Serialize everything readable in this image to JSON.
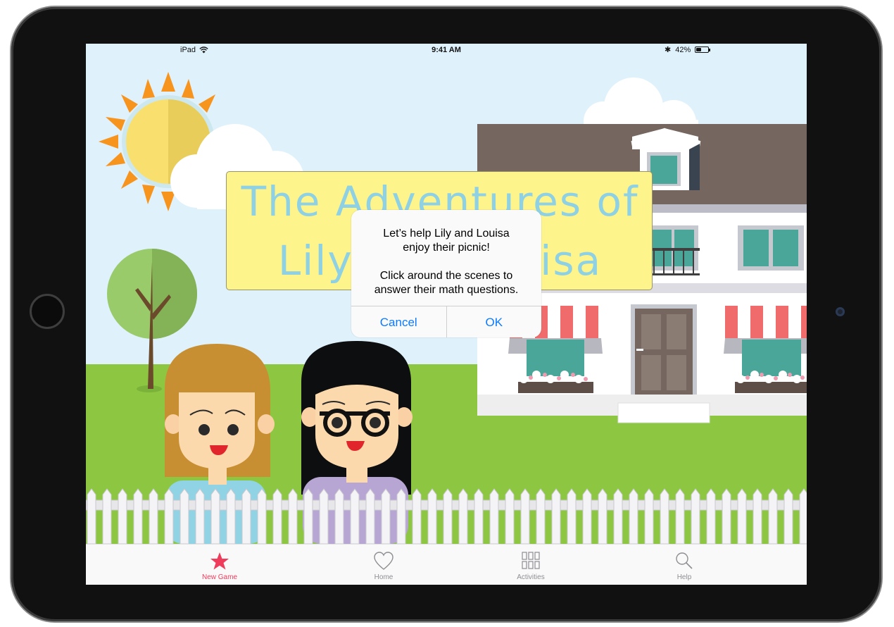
{
  "status_bar": {
    "device": "iPad",
    "time": "9:41 AM",
    "battery_text": "42%",
    "battery_level": 0.42
  },
  "title_banner": {
    "line1": "The Adventures of",
    "line2": "Lily and Louisa"
  },
  "alert": {
    "message_lines": [
      "Let’s help Lily and Louisa",
      "enjoy their picnic!",
      "",
      "Click around the scenes to",
      "answer their math questions."
    ],
    "cancel_label": "Cancel",
    "ok_label": "OK"
  },
  "tab_bar": {
    "selected": "New Game",
    "tabs": [
      {
        "label": "New Game",
        "icon": "star-icon"
      },
      {
        "label": "Home",
        "icon": "heart-icon"
      },
      {
        "label": "Activities",
        "icon": "grid-icon"
      },
      {
        "label": "Help",
        "icon": "search-icon"
      }
    ]
  },
  "colors": {
    "accent_active_tab": "#ef3b5c",
    "alert_button": "#0a7aff",
    "title_text": "#8ed1e4",
    "banner": "#fdf48c",
    "sky": "#dff1fb",
    "grass": "#8dc641"
  }
}
